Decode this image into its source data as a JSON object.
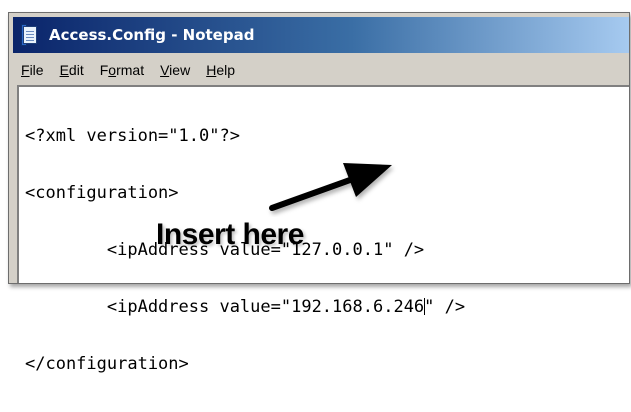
{
  "window": {
    "title": "Access.Config - Notepad",
    "icon": "notepad-icon"
  },
  "menu": [
    {
      "pre": "",
      "u": "F",
      "post": "ile"
    },
    {
      "pre": "",
      "u": "E",
      "post": "dit"
    },
    {
      "pre": "F",
      "u": "o",
      "post": "rmat"
    },
    {
      "pre": "",
      "u": "V",
      "post": "iew"
    },
    {
      "pre": "",
      "u": "H",
      "post": "elp"
    }
  ],
  "document": {
    "lines": [
      "<?xml version=\"1.0\"?>",
      "<configuration>",
      "        <ipAddress value=\"127.0.0.1\" />",
      "        <ipAddress value=\"192.168.6.246",
      "</configuration>"
    ],
    "line4_after_caret": "\" />"
  },
  "annotation": {
    "text": "Insert here"
  }
}
